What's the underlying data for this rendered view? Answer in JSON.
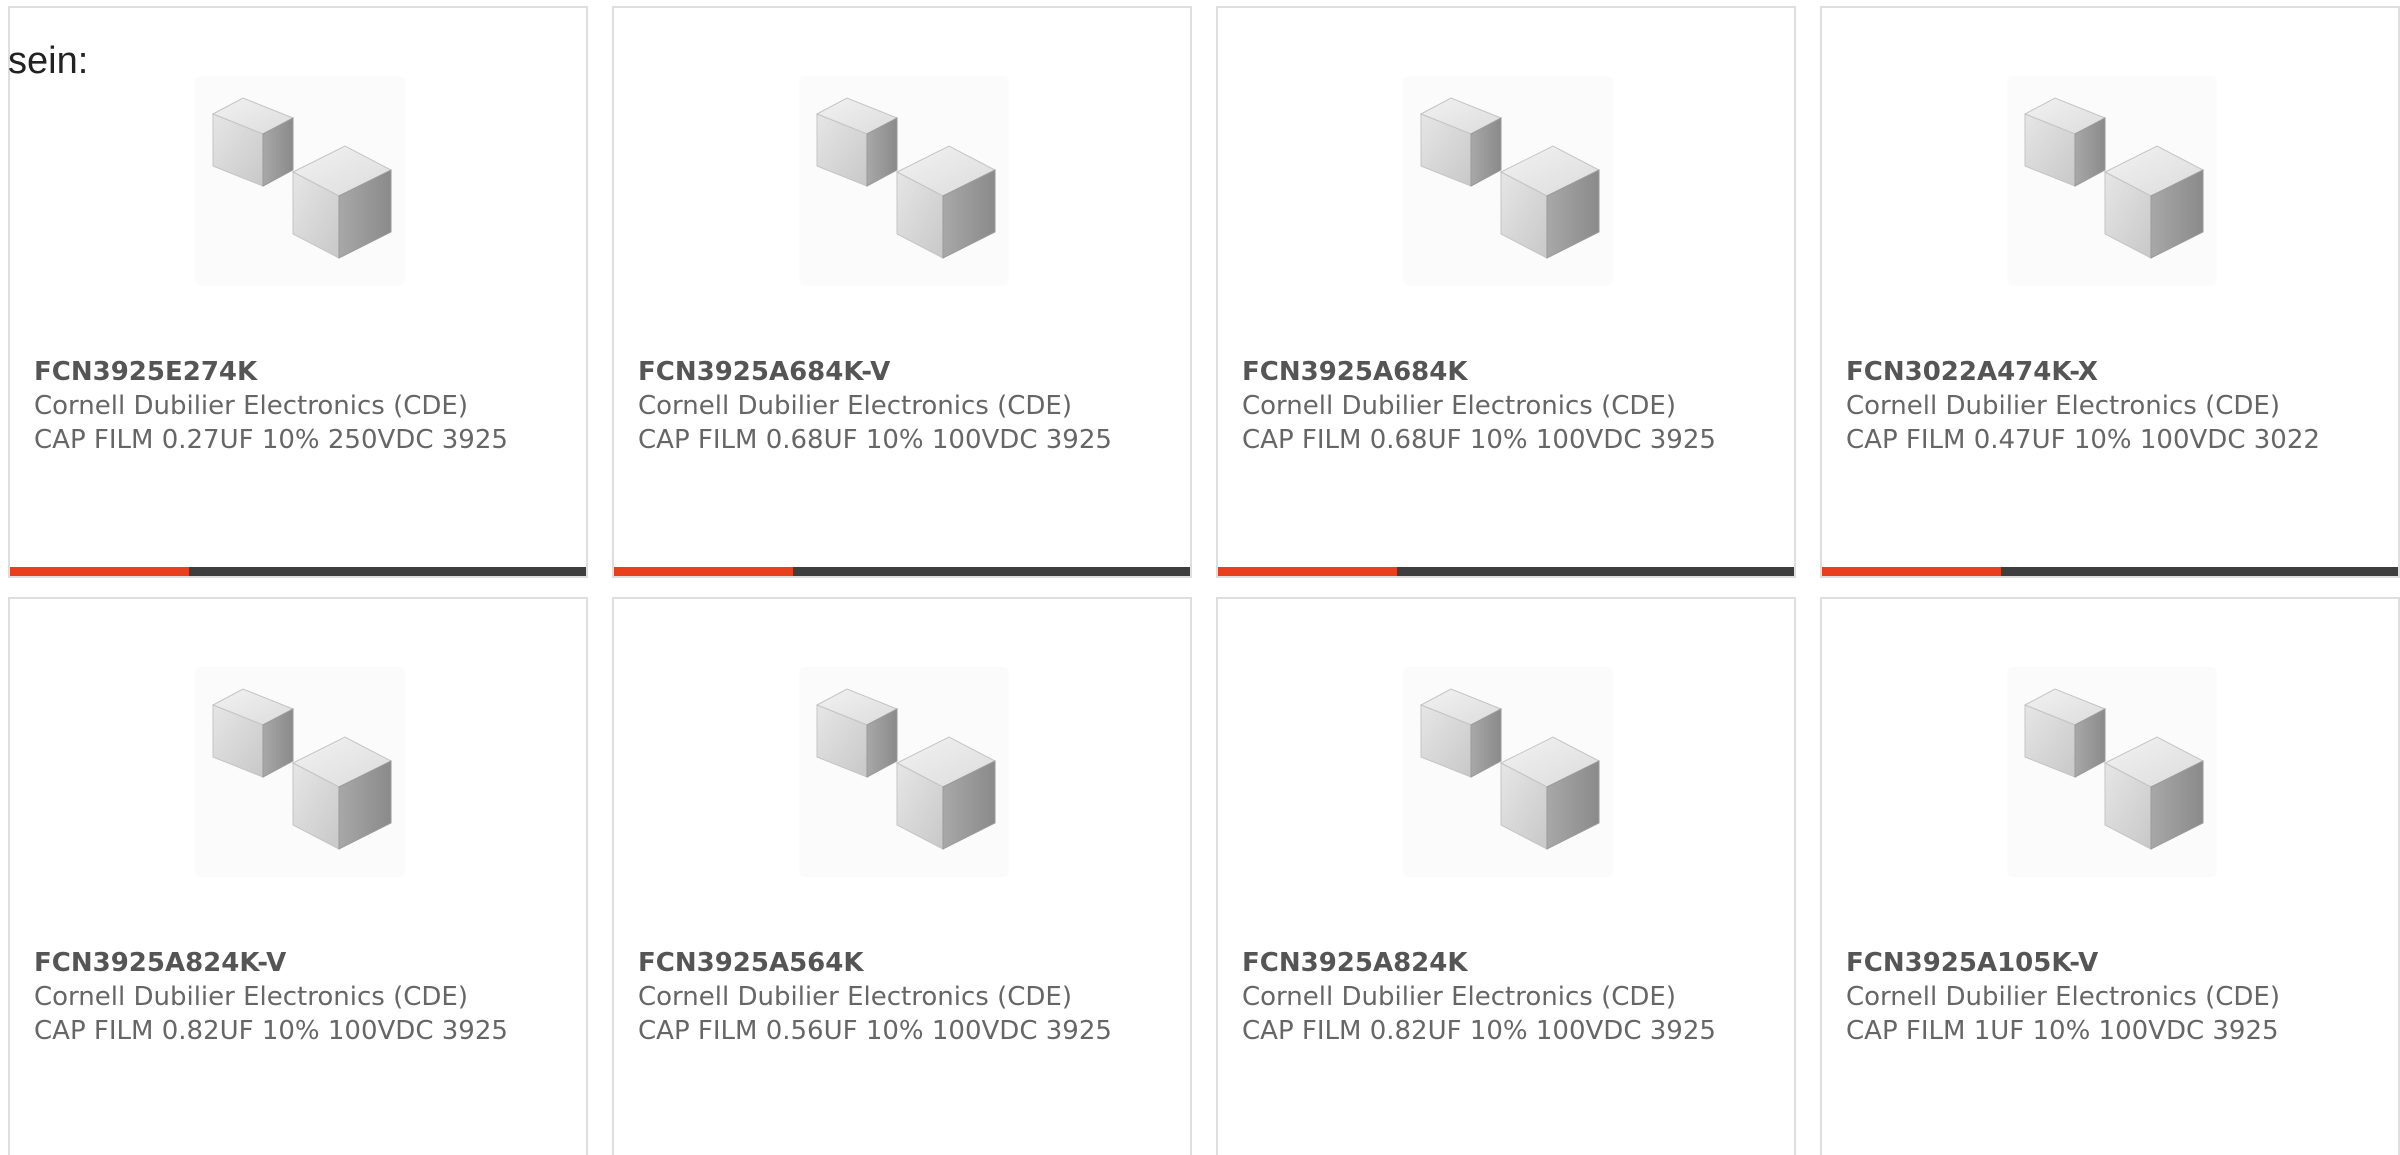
{
  "intro_text": "sein:",
  "colors": {
    "accent": "#e8401c",
    "accent_track": "#3e3e3e",
    "card_border": "#dedede",
    "text": "#666666"
  },
  "icons": {
    "product_image": "capacitor-product-icon"
  },
  "products": [
    {
      "part_number": "FCN3925E274K",
      "manufacturer": "Cornell Dubilier Electronics (CDE)",
      "description": "CAP FILM 0.27UF 10% 250VDC 3925",
      "accent_fill_fraction": 0.31
    },
    {
      "part_number": "FCN3925A684K-V",
      "manufacturer": "Cornell Dubilier Electronics (CDE)",
      "description": "CAP FILM 0.68UF 10% 100VDC 3925",
      "accent_fill_fraction": 0.31
    },
    {
      "part_number": "FCN3925A684K",
      "manufacturer": "Cornell Dubilier Electronics (CDE)",
      "description": "CAP FILM 0.68UF 10% 100VDC 3925",
      "accent_fill_fraction": 0.31
    },
    {
      "part_number": "FCN3022A474K-X",
      "manufacturer": "Cornell Dubilier Electronics (CDE)",
      "description": "CAP FILM 0.47UF 10% 100VDC 3022",
      "accent_fill_fraction": 0.31
    },
    {
      "part_number": "FCN3925A824K-V",
      "manufacturer": "Cornell Dubilier Electronics (CDE)",
      "description": "CAP FILM 0.82UF 10% 100VDC 3925"
    },
    {
      "part_number": "FCN3925A564K",
      "manufacturer": "Cornell Dubilier Electronics (CDE)",
      "description": "CAP FILM 0.56UF 10% 100VDC 3925"
    },
    {
      "part_number": "FCN3925A824K",
      "manufacturer": "Cornell Dubilier Electronics (CDE)",
      "description": "CAP FILM 0.82UF 10% 100VDC 3925"
    },
    {
      "part_number": "FCN3925A105K-V",
      "manufacturer": "Cornell Dubilier Electronics (CDE)",
      "description": "CAP FILM 1UF 10% 100VDC 3925"
    }
  ]
}
